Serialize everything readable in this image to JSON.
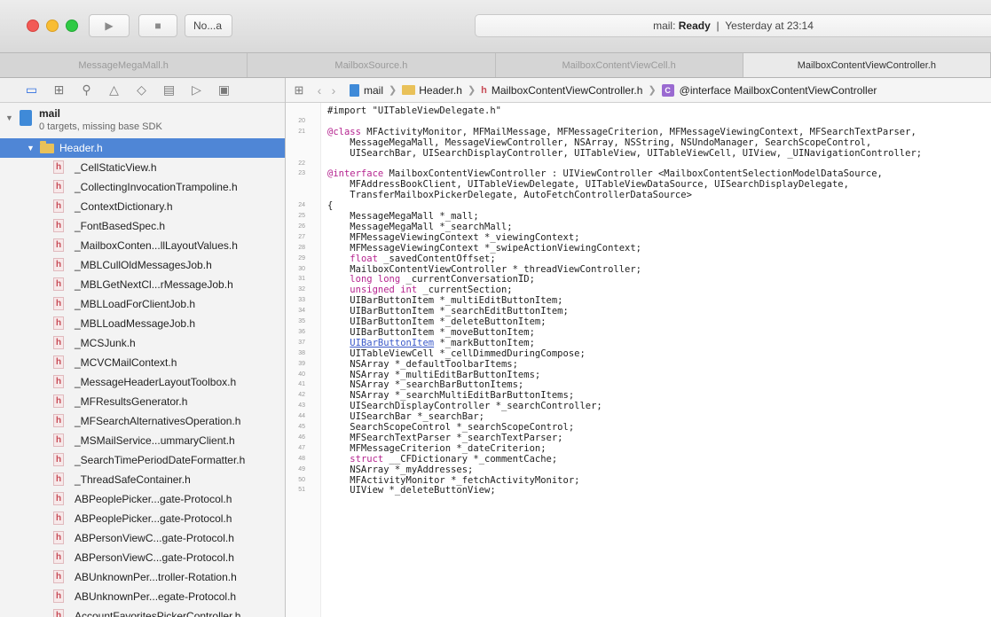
{
  "toolbar": {
    "scheme_label": "No...a",
    "status_project": "mail:",
    "status_state": "Ready",
    "status_sep": "|",
    "status_time": "Yesterday at 23:14"
  },
  "tabs": [
    {
      "label": "MessageMegaMall.h"
    },
    {
      "label": "MailboxSource.h"
    },
    {
      "label": "MailboxContentViewCell.h"
    },
    {
      "label": "MailboxContentViewController.h"
    }
  ],
  "navigator": {
    "project": {
      "name": "mail",
      "subtitle": "0 targets, missing base SDK"
    },
    "group": {
      "name": "Header.h"
    },
    "file_badge": "h",
    "files": [
      "_CellStaticView.h",
      "_CollectingInvocationTrampoline.h",
      "_ContextDictionary.h",
      "_FontBasedSpec.h",
      "_MailboxConten...llLayoutValues.h",
      "_MBLCullOldMessagesJob.h",
      "_MBLGetNextCl...rMessageJob.h",
      "_MBLLoadForClientJob.h",
      "_MBLLoadMessageJob.h",
      "_MCSJunk.h",
      "_MCVCMailContext.h",
      "_MessageHeaderLayoutToolbox.h",
      "_MFResultsGenerator.h",
      "_MFSearchAlternativesOperation.h",
      "_MSMailService...ummaryClient.h",
      "_SearchTimePeriodDateFormatter.h",
      "_ThreadSafeContainer.h",
      "ABPeoplePicker...gate-Protocol.h",
      "ABPeoplePicker...gate-Protocol.h",
      "ABPersonViewC...gate-Protocol.h",
      "ABPersonViewC...gate-Protocol.h",
      "ABUnknownPer...troller-Rotation.h",
      "ABUnknownPer...egate-Protocol.h",
      "AccountFavoritesPickerController.h"
    ]
  },
  "jumpbar": {
    "project": "mail",
    "folder": "Header.h",
    "file_badge": "h",
    "file": "MailboxContentViewController.h",
    "symbol_badge": "C",
    "symbol": "@interface MailboxContentViewController"
  },
  "editor": {
    "lines": [
      {
        "n": "",
        "t": "#import \"UITableViewDelegate.h\""
      },
      {
        "n": "20",
        "t": ""
      },
      {
        "n": "21",
        "t": "@class MFActivityMonitor, MFMailMessage, MFMessageCriterion, MFMessageViewingContext, MFSearchTextParser,"
      },
      {
        "n": "",
        "t": "    MessageMegaMall, MessageViewController, NSArray, NSString, NSUndoManager, SearchScopeControl,"
      },
      {
        "n": "",
        "t": "    UISearchBar, UISearchDisplayController, UITableView, UITableViewCell, UIView, _UINavigationController;"
      },
      {
        "n": "22",
        "t": ""
      },
      {
        "n": "23",
        "t": "@interface MailboxContentViewController : UIViewController <MailboxContentSelectionModelDataSource,"
      },
      {
        "n": "",
        "t": "    MFAddressBookClient, UITableViewDelegate, UITableViewDataSource, UISearchDisplayDelegate,"
      },
      {
        "n": "",
        "t": "    TransferMailboxPickerDelegate, AutoFetchControllerDataSource>"
      },
      {
        "n": "24",
        "t": "{"
      },
      {
        "n": "25",
        "t": "    MessageMegaMall *_mall;"
      },
      {
        "n": "26",
        "t": "    MessageMegaMall *_searchMall;"
      },
      {
        "n": "27",
        "t": "    MFMessageViewingContext *_viewingContext;"
      },
      {
        "n": "28",
        "t": "    MFMessageViewingContext *_swipeActionViewingContext;"
      },
      {
        "n": "29",
        "t": "    float _savedContentOffset;"
      },
      {
        "n": "30",
        "t": "    MailboxContentViewController *_threadViewController;"
      },
      {
        "n": "31",
        "t": "    long long _currentConversationID;"
      },
      {
        "n": "32",
        "t": "    unsigned int _currentSection;"
      },
      {
        "n": "33",
        "t": "    UIBarButtonItem *_multiEditButtonItem;"
      },
      {
        "n": "34",
        "t": "    UIBarButtonItem *_searchEditButtonItem;"
      },
      {
        "n": "35",
        "t": "    UIBarButtonItem *_deleteButtonItem;"
      },
      {
        "n": "36",
        "t": "    UIBarButtonItem *_moveButtonItem;"
      },
      {
        "n": "37",
        "t": "    UIBarButtonItem *_markButtonItem;"
      },
      {
        "n": "38",
        "t": "    UITableViewCell *_cellDimmedDuringCompose;"
      },
      {
        "n": "39",
        "t": "    NSArray *_defaultToolbarItems;"
      },
      {
        "n": "40",
        "t": "    NSArray *_multiEditBarButtonItems;"
      },
      {
        "n": "41",
        "t": "    NSArray *_searchBarButtonItems;"
      },
      {
        "n": "42",
        "t": "    NSArray *_searchMultiEditBarButtonItems;"
      },
      {
        "n": "43",
        "t": "    UISearchDisplayController *_searchController;"
      },
      {
        "n": "44",
        "t": "    UISearchBar *_searchBar;"
      },
      {
        "n": "45",
        "t": "    SearchScopeControl *_searchScopeControl;"
      },
      {
        "n": "46",
        "t": "    MFSearchTextParser *_searchTextParser;"
      },
      {
        "n": "47",
        "t": "    MFMessageCriterion *_dateCriterion;"
      },
      {
        "n": "48",
        "t": "    struct __CFDictionary *_commentCache;"
      },
      {
        "n": "49",
        "t": "    NSArray *_myAddresses;"
      },
      {
        "n": "50",
        "t": "    MFActivityMonitor *_fetchActivityMonitor;"
      },
      {
        "n": "51",
        "t": "    UIView *_deleteButtonView;"
      }
    ]
  }
}
